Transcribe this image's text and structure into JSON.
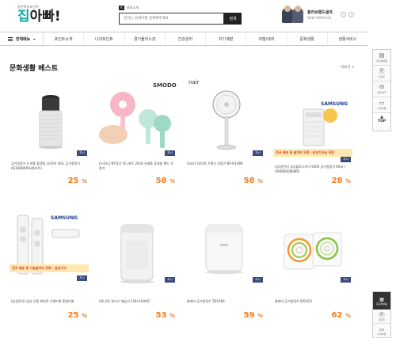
{
  "header": {
    "logo_sub": "청년복지포인트",
    "logo_main_a": "집",
    "logo_main_b": "아빠!",
    "search_tag": "K",
    "search_top_label": "하루소개",
    "search_placeholder": "원하는 검색어를 입력해주세요.",
    "search_button": "검색",
    "promo_title": "올리브랜드골프",
    "promo_sub": "NEW ARRIVALS",
    "promo_prev": "‹",
    "promo_next": "›"
  },
  "nav": {
    "all_label": "전체메뉴",
    "all_arrow": "▾",
    "items": [
      "포인트소개",
      "나의포인트",
      "경기몰리스관",
      "건강관리",
      "자기계발",
      "여행/레저",
      "문화생활",
      "생활서비스"
    ]
  },
  "section": {
    "title": "문화생활 베스트",
    "more": "더보기 +"
  },
  "products": [
    {
      "name": "공기청정기 A 세종 플렌팀 LG전자 36도 공기청정기 AS180DWFA(화이트)",
      "badge": "지시",
      "discount": "25",
      "brand": "",
      "banner": ""
    },
    {
      "name": "[스모도] NY휴기 미니포트 2018 신제품 휴대용 핸드 선풍기",
      "badge": "지시",
      "discount": "58",
      "brand": "SMODO",
      "banner": ""
    },
    {
      "name": "[nair] 14인치 기계식 선풍기 NF-H1489",
      "badge": "지시",
      "discount": "58",
      "brand": "nair",
      "banner": ""
    },
    {
      "name": "[삼성전자] 삼성블루스카이 5000 공기청정기 60㎡ / AX60N5080WD",
      "badge": "지시",
      "discount": "28",
      "brand": "SAMSUNG",
      "banner": "전국 배송 및 설치비 무료 · 삼성기사님 직접"
    },
    {
      "name": "[삼성전자] 삼성 무풍 에어컨 스탠드형 홈멀티형",
      "badge": "지시",
      "discount": "25",
      "brand": "SAMSUNG",
      "banner": "전국 배송 및 기본설치비 무료 · 삼성기사"
    },
    {
      "name": "[위니아] 위닉스 제습기 CDH-160AD",
      "badge": "지시",
      "discount": "53",
      "brand": "",
      "banner": ""
    },
    {
      "name": "쿨에어 공기청정기 TD1666",
      "badge": "지시",
      "discount": "59",
      "brand": "",
      "banner": ""
    },
    {
      "name": "쿨에어 공기청정기 SP2025",
      "badge": "지시",
      "discount": "62",
      "brand": "",
      "banner": ""
    }
  ],
  "percent_sign": "%",
  "sidebar": {
    "items": [
      {
        "icon": "▤",
        "label": "최근본상품"
      },
      {
        "icon": "Ⓟ",
        "label": "포인트"
      },
      {
        "icon": "✉",
        "label": "문의하기"
      },
      {
        "icon": "▭",
        "label": "나의쿠폰"
      }
    ],
    "top_label": "TOP",
    "top_arrow": "▲",
    "bottom_dark_icon": "▦",
    "bottom_dark_label": "최근본상품",
    "bottom_items": [
      {
        "icon": "Ⓟ",
        "label": "포인트"
      },
      {
        "icon": "▭",
        "label": "나의쿠폰"
      }
    ]
  },
  "colors": {
    "accent_orange": "#f47a20",
    "badge_navy": "#3a4a7a",
    "logo_teal": "#15a6a8"
  }
}
